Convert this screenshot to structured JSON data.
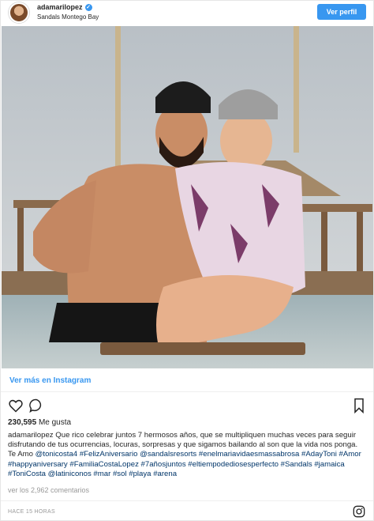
{
  "header": {
    "username": "adamarilopez",
    "location": "Sandals Montego Bay",
    "follow_label": "Ver perfil"
  },
  "view_more_label": "Ver más en Instagram",
  "likes": {
    "count": "230,595",
    "label": "Me gusta"
  },
  "caption": {
    "username": "adamarilopez",
    "text": "Que rico celebrar juntos 7 hermosos años, que se multipliquen muchas veces para seguir disfrutando de tus ocurrencias, locuras, sorpresas y que sigamos bailando al son que la vida nos ponga. Te Amo",
    "tags": [
      "@tonicosta4",
      "#FelizAniversario",
      "@sandalsresorts",
      "#enelmariavidaesmassabrosa",
      "#AdayToni",
      "#Amor",
      "#happyaniversary",
      "#FamiliaCostaLopez",
      "#7añosjuntos",
      "#eltiempodediosesperfecto",
      "#Sandals",
      "#jamaica",
      "#ToniCosta",
      "@latiniconos",
      "#mar",
      "#sol",
      "#playa",
      "#arena"
    ]
  },
  "comments_label": "ver los 2,962 comentarios",
  "timestamp": "HACE 15 HORAS",
  "colors": {
    "accent": "#3897f0",
    "hashtag": "#003569"
  },
  "icons": [
    "verified-badge-icon",
    "heart-icon",
    "comment-icon",
    "bookmark-icon",
    "instagram-icon"
  ]
}
